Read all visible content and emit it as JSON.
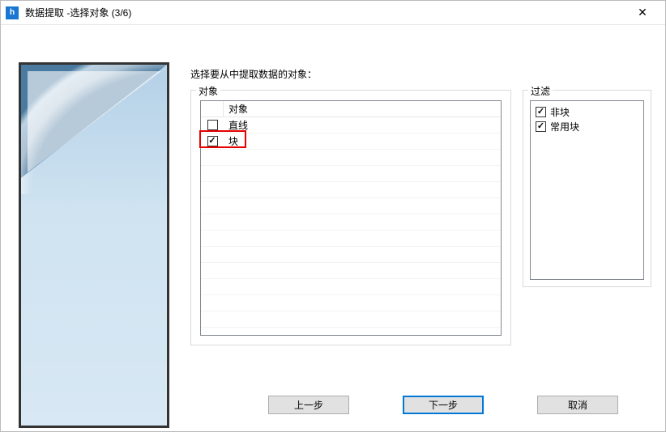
{
  "window": {
    "title": "数据提取 -选择对象 (3/6)",
    "close_icon": "✕"
  },
  "instruction": "选择要从中提取数据的对象：",
  "objects": {
    "legend": "对象",
    "header": "对象",
    "items": [
      {
        "label": "直线",
        "checked": false
      },
      {
        "label": "块",
        "checked": true
      }
    ]
  },
  "filter": {
    "legend": "过滤",
    "items": [
      {
        "label": "非块",
        "checked": true
      },
      {
        "label": "常用块",
        "checked": true
      }
    ]
  },
  "buttons": {
    "back": "上一步",
    "next": "下一步",
    "cancel": "取消"
  }
}
